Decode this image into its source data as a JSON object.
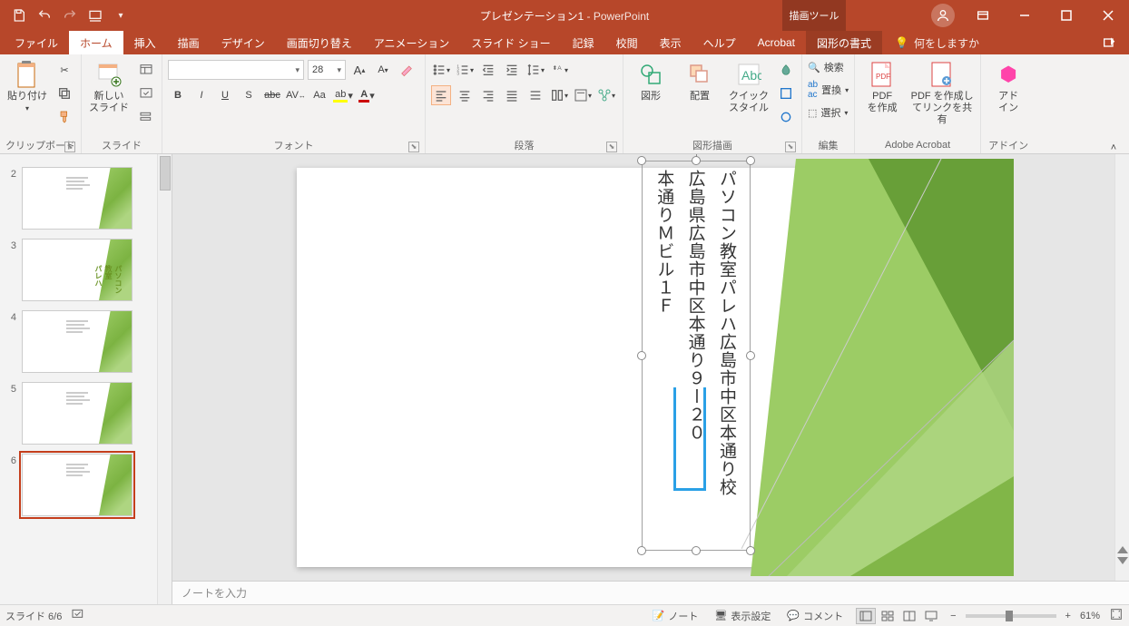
{
  "titlebar": {
    "doc": "プレゼンテーション1",
    "app": "PowerPoint",
    "contextual_tab": "描画ツール"
  },
  "tabs": {
    "file": "ファイル",
    "home": "ホーム",
    "insert": "挿入",
    "draw": "描画",
    "design": "デザイン",
    "transitions": "画面切り替え",
    "animations": "アニメーション",
    "slideshow": "スライド ショー",
    "record": "記録",
    "review": "校閲",
    "view": "表示",
    "help": "ヘルプ",
    "acrobat": "Acrobat",
    "format": "図形の書式",
    "tell_me": "何をしますか"
  },
  "ribbon": {
    "clipboard": {
      "label": "クリップボード",
      "paste": "貼り付け"
    },
    "slides": {
      "label": "スライド",
      "new_slide": "新しい\nスライド"
    },
    "font": {
      "label": "フォント",
      "font_name": "",
      "font_size": "28",
      "b": "B",
      "i": "I",
      "u": "U",
      "s": "S",
      "strike": "abc",
      "av": "AV",
      "aa": "Aa"
    },
    "paragraph": {
      "label": "段落"
    },
    "drawing": {
      "label": "図形描画",
      "shapes": "図形",
      "arrange": "配置",
      "quick_styles": "クイック\nスタイル"
    },
    "editing": {
      "label": "編集",
      "find": "検索",
      "replace": "置換",
      "select": "選択"
    },
    "adobe": {
      "label": "Adobe Acrobat",
      "create_pdf": "PDF\nを作成",
      "share_pdf": "PDF を作成し\nてリンクを共有"
    },
    "addins": {
      "label": "アドイン",
      "addins_btn": "アド\nイン"
    }
  },
  "slide_content": {
    "line1": "パソコン教室パレハ広島市中区本通り校",
    "line2": "広島県広島市中区本通り９ー２０",
    "line3": "本通りＭビル１Ｆ"
  },
  "thumbs": {
    "items": [
      "",
      "2",
      "3",
      "4",
      "5",
      "6"
    ],
    "selected_index": 5
  },
  "notes": {
    "placeholder": "ノートを入力"
  },
  "statusbar": {
    "slide_pos": "スライド 6/6",
    "notes": "ノート",
    "display_settings": "表示設定",
    "comments": "コメント",
    "zoom": "61%"
  }
}
